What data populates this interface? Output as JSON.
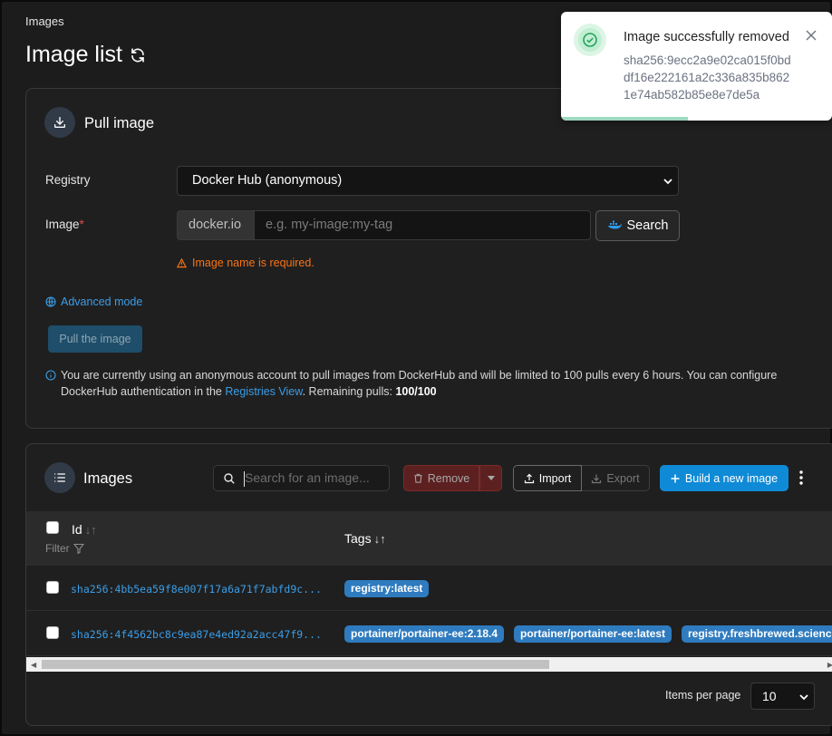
{
  "breadcrumb": "Images",
  "page_title": "Image list",
  "pull_card": {
    "title": "Pull image",
    "registry_label": "Registry",
    "registry_value": "Docker Hub (anonymous)",
    "image_label": "Image",
    "required_marker": "*",
    "image_prefix": "docker.io",
    "image_placeholder": "e.g. my-image:my-tag",
    "search_label": "Search",
    "warning": "Image name is required.",
    "advanced_mode": "Advanced mode",
    "pull_button": "Pull the image",
    "info_text_1": "You are currently using an anonymous account to pull images from DockerHub and will be limited to 100 pulls every 6 hours. You can configure DockerHub authentication in the ",
    "info_link": "Registries View",
    "info_text_2": ". Remaining pulls: ",
    "remaining_pulls": "100/100"
  },
  "images_card": {
    "title": "Images",
    "search_placeholder": "Search for an image...",
    "remove_label": "Remove",
    "import_label": "Import",
    "export_label": "Export",
    "build_label": "Build a new image",
    "columns": {
      "id": "Id",
      "filter": "Filter",
      "tags": "Tags"
    },
    "rows": [
      {
        "id": "sha256:4bb5ea59f8e007f17a6a71f7abfd9c...",
        "tags": [
          "registry:latest"
        ]
      },
      {
        "id": "sha256:4f4562bc8c9ea87e4ed92a2acc47f9...",
        "tags": [
          "portainer/portainer-ee:2.18.4",
          "portainer/portainer-ee:latest",
          "registry.freshbrewed.science"
        ]
      }
    ],
    "items_per_page_label": "Items per page",
    "items_per_page_value": "10"
  },
  "toast": {
    "title": "Image successfully removed",
    "message": "sha256:9ecc2a9e02ca015f0bddf16e222161a2c336a835b8621e74ab582b85e8e7de5a"
  },
  "colors": {
    "accent_blue": "#0f8ad6",
    "link_blue": "#3b9ee8",
    "warning_orange": "#f97316",
    "danger_red": "#5c2020",
    "tag_blue": "#2f7bbf",
    "success_green": "#22a45d"
  }
}
